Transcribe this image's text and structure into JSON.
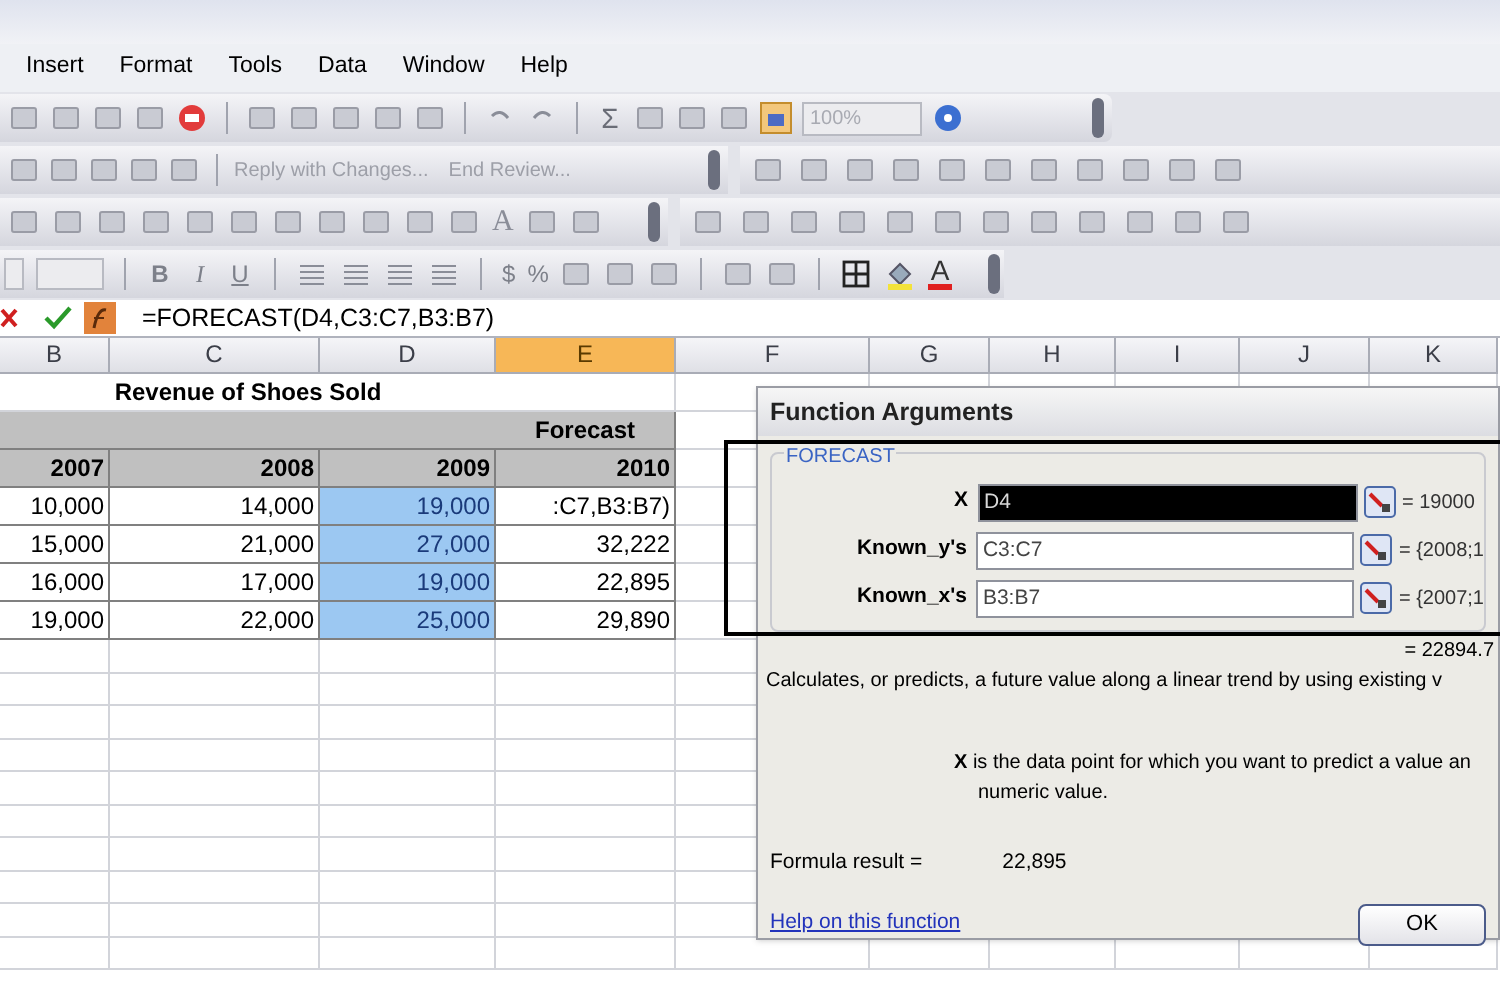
{
  "menu": [
    "Insert",
    "Format",
    "Tools",
    "Data",
    "Window",
    "Help"
  ],
  "standard_toolbar": {
    "sum": "Σ",
    "zoom": "100%"
  },
  "review_toolbar": {
    "reply": "Reply with Changes...",
    "end": "End Review..."
  },
  "drawing_toolbar": {
    "letter": "A"
  },
  "formatting_toolbar": {
    "styles": [
      "B",
      "I",
      "U"
    ],
    "currency": "$",
    "percent": "%",
    "font_color": "A"
  },
  "formula_bar": {
    "formula": "=FORECAST(D4,C3:C7,B3:B7)"
  },
  "sheet": {
    "columns": [
      {
        "label": "B",
        "selected": false
      },
      {
        "label": "C",
        "selected": false
      },
      {
        "label": "D",
        "selected": false
      },
      {
        "label": "E",
        "selected": true
      },
      {
        "label": "F",
        "selected": false
      },
      {
        "label": "G",
        "selected": false
      },
      {
        "label": "H",
        "selected": false
      },
      {
        "label": "I",
        "selected": false
      },
      {
        "label": "J",
        "selected": false
      },
      {
        "label": "K",
        "selected": false
      }
    ],
    "title": "Revenue of Shoes Sold",
    "group_header": "Forecast",
    "years": [
      "2007",
      "2008",
      "2009",
      "2010"
    ],
    "rows": [
      [
        {
          "text": "10,000",
          "selected": false
        },
        {
          "text": "14,000",
          "selected": false
        },
        {
          "text": "19,000",
          "selected": true
        },
        {
          "text": ":C7,B3:B7)",
          "selected": false
        }
      ],
      [
        {
          "text": "15,000",
          "selected": false
        },
        {
          "text": "21,000",
          "selected": false
        },
        {
          "text": "27,000",
          "selected": true
        },
        {
          "text": "32,222",
          "selected": false
        }
      ],
      [
        {
          "text": "16,000",
          "selected": false
        },
        {
          "text": "17,000",
          "selected": false
        },
        {
          "text": "19,000",
          "selected": true
        },
        {
          "text": "22,895",
          "selected": false
        }
      ],
      [
        {
          "text": "19,000",
          "selected": false
        },
        {
          "text": "22,000",
          "selected": false
        },
        {
          "text": "25,000",
          "selected": true
        },
        {
          "text": "29,890",
          "selected": false
        }
      ]
    ]
  },
  "dialog": {
    "title": "Function Arguments",
    "function": "FORECAST",
    "arguments": [
      {
        "label": "X",
        "value": "D4",
        "selected": true,
        "result": "= 19000"
      },
      {
        "label": "Known_y's",
        "value": "C3:C7",
        "selected": false,
        "result": "= {2008;1"
      },
      {
        "label": "Known_x's",
        "value": "B3:B7",
        "selected": false,
        "result": "= {2007;1"
      }
    ],
    "total": "= 22894.7",
    "description": "Calculates, or predicts, a future value along a linear trend by using existing v",
    "argument_help": [
      "**X** is the data point for which you want to predict a value an",
      "numeric value."
    ],
    "result_label": "Formula result =",
    "result_value": "22,895",
    "help_link": "Help on this function",
    "ok": "OK"
  }
}
